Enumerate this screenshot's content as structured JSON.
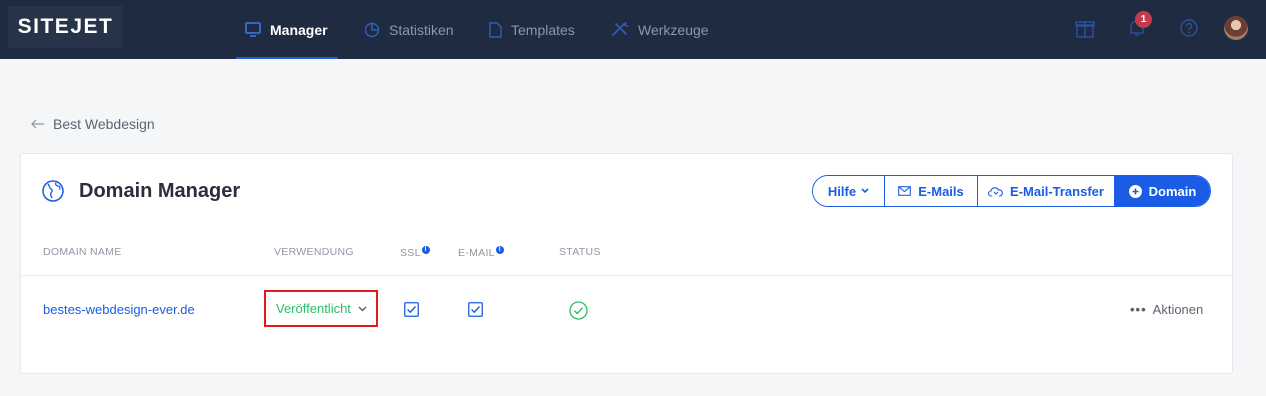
{
  "brand": {
    "logo": "SITEJET"
  },
  "nav": {
    "items": [
      {
        "label": "Manager",
        "icon": "monitor-icon",
        "active": true
      },
      {
        "label": "Statistiken",
        "icon": "pie-chart-icon",
        "active": false
      },
      {
        "label": "Templates",
        "icon": "document-icon",
        "active": false
      },
      {
        "label": "Werkzeuge",
        "icon": "tools-icon",
        "active": false
      }
    ],
    "notification_count": "1"
  },
  "breadcrumb": {
    "back_label": "Best Webdesign"
  },
  "card": {
    "title": "Domain Manager",
    "buttons": {
      "hilfe": "Hilfe",
      "emails": "E-Mails",
      "transfer": "E-Mail-Transfer",
      "domain": "Domain"
    },
    "columns": {
      "domain_name": "DOMAIN NAME",
      "usage": "VERWENDUNG",
      "ssl": "SSL",
      "email": "E-MAIL",
      "status": "STATUS"
    },
    "rows": [
      {
        "domain": "bestes-webdesign-ever.de",
        "usage": "Veröffentlicht",
        "ssl": true,
        "email": true,
        "status": "ok",
        "actions": "Aktionen"
      }
    ]
  },
  "colors": {
    "nav_bg": "#1f2b40",
    "accent": "#1a5ce5",
    "published_green": "#2ebd6b",
    "highlight_red": "#e01b1b",
    "badge_red": "#c63a4f"
  }
}
